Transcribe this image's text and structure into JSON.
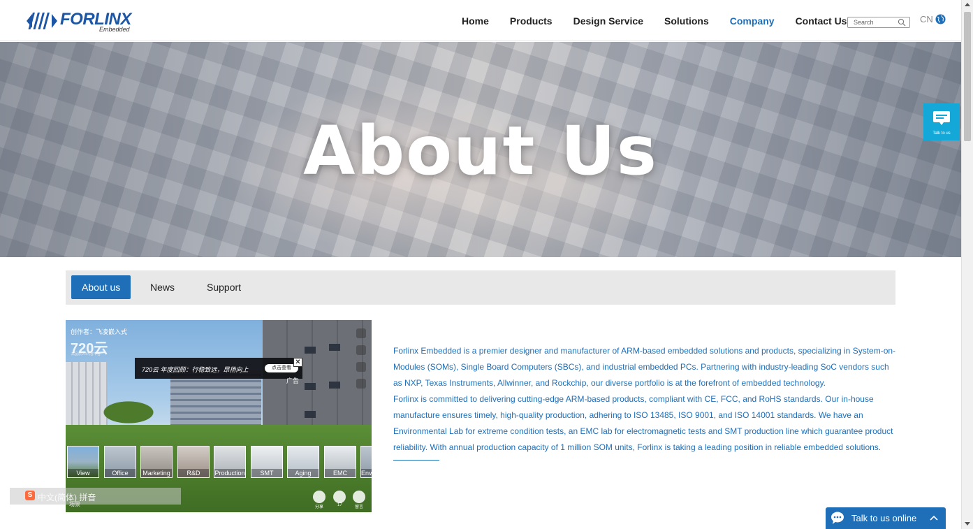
{
  "header": {
    "logo_word": "FORLINX",
    "logo_sub": "Embedded",
    "nav": [
      {
        "label": "Home"
      },
      {
        "label": "Products"
      },
      {
        "label": "Design Service"
      },
      {
        "label": "Solutions"
      },
      {
        "label": "Company"
      },
      {
        "label": "Contact Us"
      }
    ],
    "active_nav": "Company",
    "search_placeholder": "Search",
    "lang": "CN"
  },
  "hero": {
    "title": "About Us"
  },
  "side_widget": {
    "label": "Talk to us"
  },
  "tabs": [
    {
      "label": "About us"
    },
    {
      "label": "News"
    },
    {
      "label": "Support"
    }
  ],
  "active_tab": "About us",
  "panorama": {
    "credit": "创作者：飞凌嵌入式",
    "brand": "720云",
    "brand_sub": "高品质VR内容平台",
    "ad_text": "720云 年度回顾：行稳致远，昂扬向上",
    "ad_button": "点击查看",
    "ad_tag": "广告",
    "close": "✕",
    "thumbnails": [
      "View",
      "Office",
      "Marketing",
      "R&D",
      "Production",
      "SMT",
      "Aging",
      "EMC",
      "Enviro"
    ],
    "scene_label": "场景",
    "bottom_buttons": [
      {
        "label": "分享"
      },
      {
        "label": "17"
      },
      {
        "label": "留言"
      }
    ]
  },
  "ime": {
    "logo": "S",
    "text": "中文(简体) 拼音"
  },
  "about": {
    "paragraph1": "Forlinx Embedded is a premier designer and manufacturer of ARM-based embedded solutions and products, specializing in System-on-Modules (SOMs), Single Board Computers (SBCs), and industrial embedded PCs. Partnering with industry-leading SoC vendors such as NXP, Texas Instruments, Allwinner, and Rockchip, our diverse portfolio is at the forefront of embedded technology.",
    "paragraph2": "Forlinx is committed to delivering cutting-edge ARM-based products, compliant with CE, FCC, and RoHS standards. Our in-house manufacture ensures timely, high-quality production, adhering to ISO 13485, ISO 9001, and ISO 14001 standards. We have an Environmental Lab for extreme condition tests, an EMC lab for electromagnetic tests and SMT production line which guarantee product reliability. With annual production capacity of 1 million SOM units, Forlinx is taking a leading position in reliable embedded solutions."
  },
  "chat": {
    "label": "Talk to us online"
  },
  "colors": {
    "brand_blue": "#1e6fb8",
    "logo_blue": "#1e56a6",
    "side_widget": "#14a8d8",
    "tab_bar": "#e8e8e8"
  }
}
